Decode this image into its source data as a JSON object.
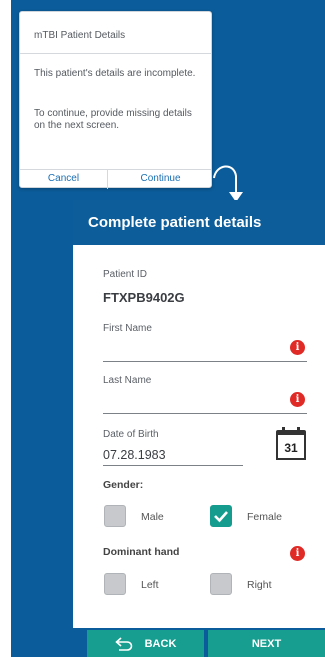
{
  "dialog": {
    "title": "mTBI Patient Details",
    "message1": "This patient's details are incomplete.",
    "message2": "To continue, provide missing details on the next screen.",
    "cancel_label": "Cancel",
    "continue_label": "Continue"
  },
  "panel": {
    "title": "Complete patient details",
    "patient_id_label": "Patient ID",
    "patient_id_value": "FTXPB9402G",
    "first_name_label": "First Name",
    "first_name_value": "",
    "last_name_label": "Last Name",
    "last_name_value": "",
    "dob_label": "Date of Birth",
    "dob_value": "07.28.1983",
    "calendar_day": "31",
    "gender_label": "Gender:",
    "gender_options": [
      {
        "label": "Male",
        "checked": false
      },
      {
        "label": "Female",
        "checked": true
      }
    ],
    "dominant_hand_label": "Dominant hand",
    "hand_options": [
      {
        "label": "Left",
        "checked": false
      },
      {
        "label": "Right",
        "checked": false
      }
    ],
    "info_glyph": "i"
  },
  "footer": {
    "back_label": "BACK",
    "next_label": "NEXT"
  },
  "colors": {
    "background_blue": "#0b5c9a",
    "accent_teal": "#179e90",
    "alert_red": "#e02a26",
    "link_blue": "#1a6fb3"
  },
  "icons": {
    "info": "info-icon",
    "calendar": "calendar-icon",
    "checkmark": "checkmark-icon",
    "back": "back-arrow-icon",
    "curved_arrow": "curved-arrow-icon"
  }
}
